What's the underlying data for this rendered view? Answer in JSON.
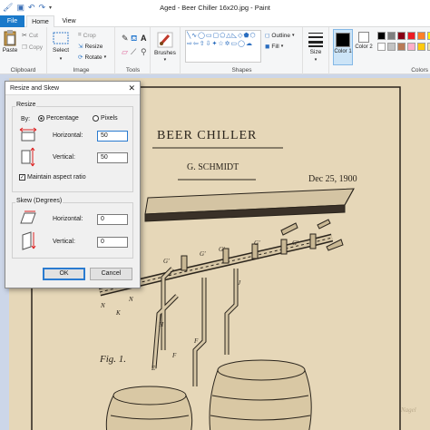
{
  "window": {
    "title": "Aged - Beer Chiller 16x20.jpg - Paint"
  },
  "tabs": [
    {
      "label": "File"
    },
    {
      "label": "Home"
    },
    {
      "label": "View"
    }
  ],
  "ribbon": {
    "clipboard": {
      "paste": "Paste",
      "cut": "Cut",
      "copy": "Copy",
      "group": "Clipboard"
    },
    "image": {
      "select": "Select",
      "crop": "Crop",
      "resize": "Resize",
      "rotate": "Rotate",
      "group": "Image"
    },
    "tools": {
      "group": "Tools"
    },
    "brushes": {
      "label": "Brushes"
    },
    "shapes": {
      "outline": "Outline",
      "fill": "Fill",
      "group": "Shapes"
    },
    "size": {
      "label": "Size"
    },
    "colors": {
      "color1": "Color 1",
      "color2": "Color 2",
      "group": "Colors",
      "palette": [
        "#000000",
        "#7f7f7f",
        "#880015",
        "#ed1c24",
        "#ff7f27",
        "#fff200",
        "#ffffff",
        "#c3c3c3",
        "#b97a57",
        "#ffaec9",
        "#ffc90e",
        "#efe4b0"
      ]
    }
  },
  "patent": {
    "title": "BEER CHILLER",
    "inventor": "G. SCHMIDT",
    "date": "Dec 25, 1900",
    "figure": "Fig. 1.",
    "part_labels": [
      "G'",
      "G'",
      "G'",
      "G'",
      "G'",
      "J",
      "J",
      "N",
      "N",
      "K",
      "H",
      "F",
      "F",
      "E"
    ],
    "signature": "Nagel"
  },
  "dialog": {
    "title": "Resize and Skew",
    "close": "✕",
    "resize_group": "Resize",
    "by_label": "By:",
    "percentage": "Percentage",
    "pixels": "Pixels",
    "horizontal_label": "Horizontal:",
    "horizontal_value": "50",
    "vertical_label": "Vertical:",
    "vertical_value": "50",
    "maintain_aspect": "Maintain aspect ratio",
    "skew_group": "Skew (Degrees)",
    "skew_horizontal_label": "Horizontal:",
    "skew_horizontal_value": "0",
    "skew_vertical_label": "Vertical:",
    "skew_vertical_value": "0",
    "ok": "OK",
    "cancel": "Cancel"
  }
}
